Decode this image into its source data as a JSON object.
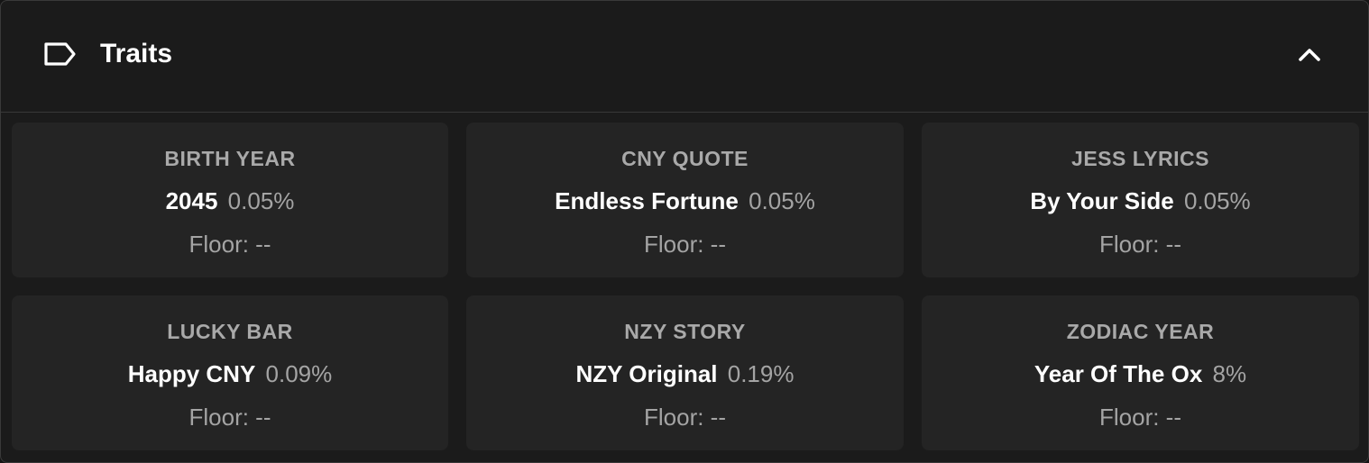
{
  "header": {
    "title": "Traits",
    "icon": "tag-icon",
    "toggle_icon": "chevron-up-icon"
  },
  "traits": [
    {
      "type": "BIRTH YEAR",
      "value": "2045",
      "percent": "0.05%",
      "floor": "Floor: --"
    },
    {
      "type": "CNY QUOTE",
      "value": "Endless Fortune",
      "percent": "0.05%",
      "floor": "Floor: --"
    },
    {
      "type": "JESS LYRICS",
      "value": "By Your Side",
      "percent": "0.05%",
      "floor": "Floor: --"
    },
    {
      "type": "LUCKY BAR",
      "value": "Happy CNY",
      "percent": "0.09%",
      "floor": "Floor: --"
    },
    {
      "type": "NZY STORY",
      "value": "NZY Original",
      "percent": "0.19%",
      "floor": "Floor: --"
    },
    {
      "type": "ZODIAC YEAR",
      "value": "Year Of The Ox",
      "percent": "8%",
      "floor": "Floor: --"
    }
  ],
  "colors": {
    "background": "#1b1b1b",
    "card": "#242424",
    "label": "#a9a9a9",
    "value": "#ffffff"
  }
}
